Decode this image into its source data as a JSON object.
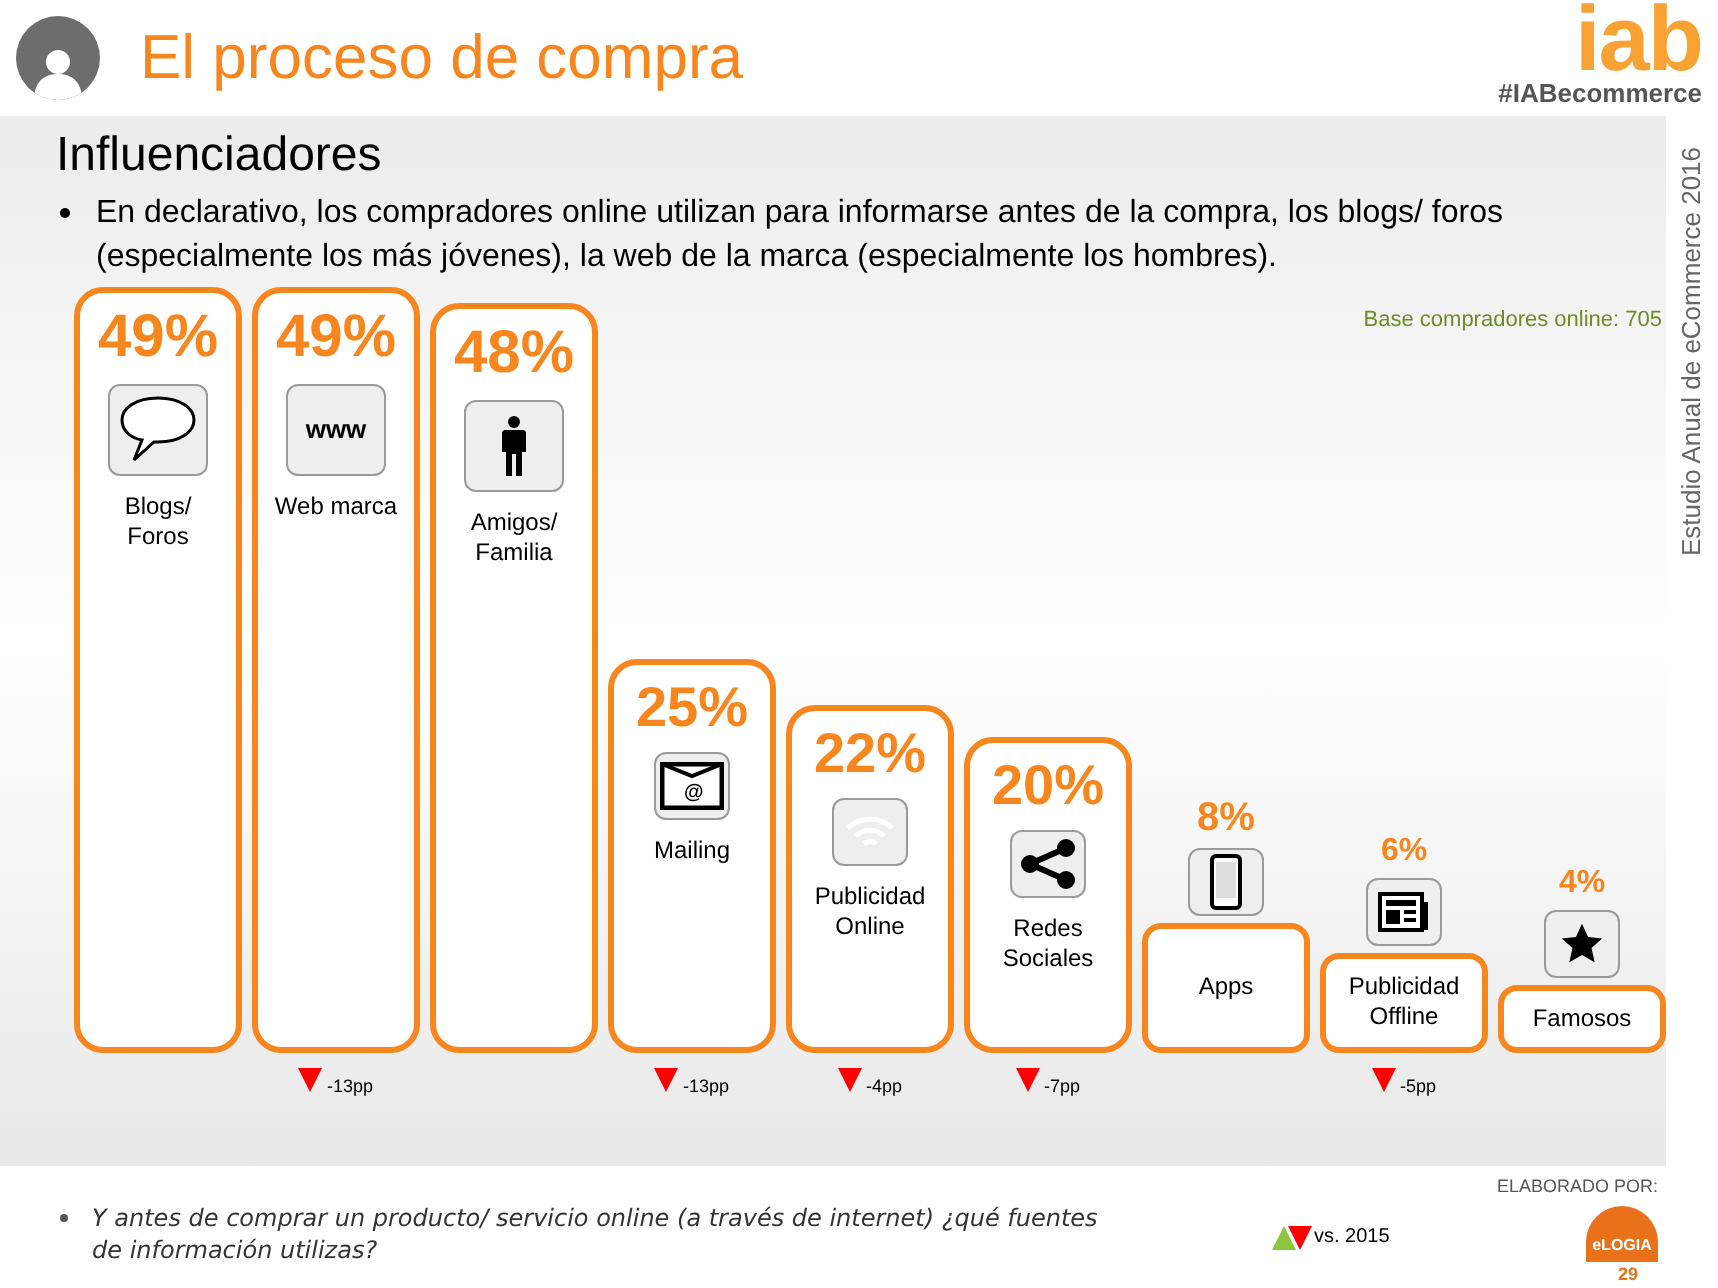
{
  "header": {
    "title": "El proceso de compra",
    "logo": "iab",
    "hashtag": "#IABecommerce"
  },
  "side_note": "Estudio Anual de eCommerce 2016",
  "section_title": "Influenciadores",
  "bullet": "En declarativo, los compradores online utilizan para informarse antes de la compra, los blogs/ foros (especialmente los más jóvenes), la web de la marca (especialmente los hombres).",
  "base_note": "Base compradores online: 705",
  "chart": {
    "chart_data": {
      "type": "bar",
      "categories": [
        "Blogs/ Foros",
        "Web marca",
        "Amigos/ Familia",
        "Mailing",
        "Publicidad Online",
        "Redes Sociales",
        "Apps",
        "Publicidad Offline",
        "Famosos"
      ],
      "values": [
        49,
        49,
        48,
        25,
        22,
        20,
        8,
        6,
        4
      ],
      "value_labels": [
        "49%",
        "49%",
        "48%",
        "25%",
        "22%",
        "20%",
        "8%",
        "6%",
        "4%"
      ]
    },
    "columns": [
      {
        "kind": "tall"
      },
      {
        "kind": "tall",
        "icon_text": "www",
        "change": "-13pp"
      },
      {
        "kind": "tall"
      },
      {
        "kind": "tall",
        "icon_text": "@",
        "change": "-13pp"
      },
      {
        "kind": "tall",
        "change": "-4pp"
      },
      {
        "kind": "tall",
        "change": "-7pp"
      },
      {
        "kind": "short"
      },
      {
        "kind": "short",
        "change": "-5pp"
      },
      {
        "kind": "short"
      }
    ]
  },
  "footnote": "Y antes de comprar un producto/ servicio online (a través de internet) ¿qué fuentes de información utilizas?",
  "legend": "vs. 2015",
  "credit": {
    "label": "ELABORADO POR:",
    "logo": "eLOGIA",
    "page": "29"
  }
}
